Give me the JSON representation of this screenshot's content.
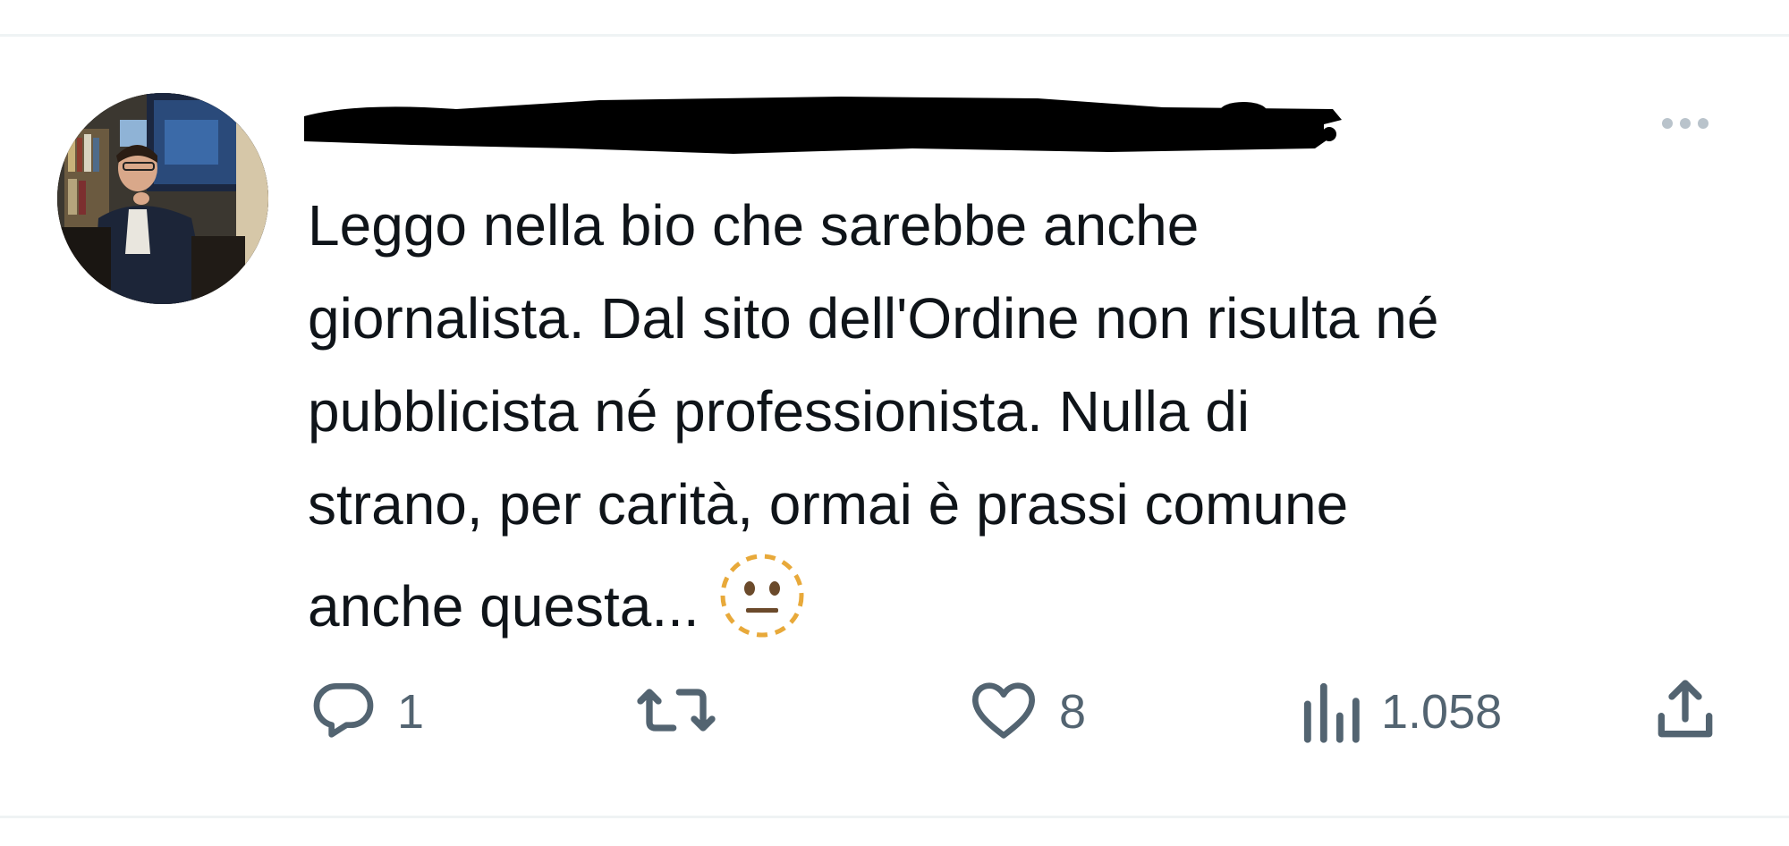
{
  "tweet": {
    "author": {
      "name_redacted": true
    },
    "text": "Leggo nella bio che sarebbe anche\ngiornalista. Dal sito dell'Ordine non risulta né\npubblicista né professionista. Nulla di\nstrano, per carità, ormai è prassi comune\nanche questa...",
    "emoji": "dotted-line-face"
  },
  "actions": {
    "reply": {
      "icon": "reply-icon",
      "count": "1"
    },
    "retweet": {
      "icon": "retweet-icon"
    },
    "like": {
      "icon": "heart-icon",
      "count": "8"
    },
    "views": {
      "icon": "views-icon",
      "count": "1.058"
    },
    "share": {
      "icon": "share-icon"
    }
  },
  "colors": {
    "icon_gray": "#536471",
    "more_dots": "#b9c3cb",
    "divider": "#eff3f4",
    "text": "#0f1419",
    "emoji_outline": "#e8a93a"
  }
}
